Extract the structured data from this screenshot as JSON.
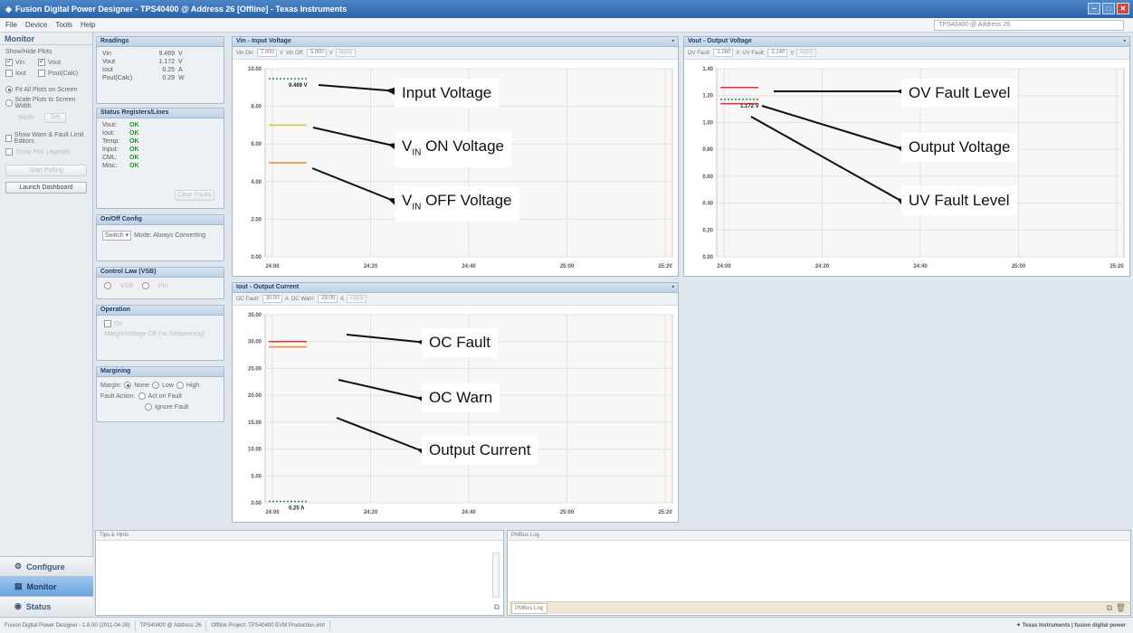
{
  "window": {
    "title": "Fusion Digital Power Designer - TPS40400 @ Address 26 [Offline] - Texas Instruments"
  },
  "menu": {
    "items": [
      "File",
      "Device",
      "Tools",
      "Help"
    ],
    "address": "TPS40400 @ Address 26"
  },
  "nav": {
    "title": "Monitor",
    "show_hide_label": "Show/Hide Plots",
    "checks": [
      {
        "label": "Vin",
        "checked": true
      },
      {
        "label": "Vout",
        "checked": true
      },
      {
        "label": "Iout",
        "checked": false
      },
      {
        "label": "Pout(Calc)",
        "checked": false
      }
    ],
    "fit_all": "Fit All Plots on Screen",
    "scale": "Scale Plots to Screen Width",
    "width_label": "Width",
    "set_label": "Set",
    "show_warn": "Show Warn & Fault Limit Editors",
    "show_plot_legends": "Show Plot Legends",
    "start_polling": "Start Polling",
    "launch_dashboard": "Launch Dashboard",
    "tabs": [
      "Configure",
      "Monitor",
      "Status"
    ]
  },
  "readings": {
    "title": "Readings",
    "rows": [
      {
        "k": "Vin",
        "v": "9.469",
        "u": "V"
      },
      {
        "k": "Vout",
        "v": "1.172",
        "u": "V"
      },
      {
        "k": "Iout",
        "v": "0.25",
        "u": "A"
      },
      {
        "k": "Pout(Calc)",
        "v": "0.29",
        "u": "W"
      }
    ]
  },
  "status_regs": {
    "title": "Status Registers/Lines",
    "rows": [
      {
        "k": "Vout:",
        "v": "OK"
      },
      {
        "k": "Iout:",
        "v": "OK"
      },
      {
        "k": "Temp:",
        "v": "OK"
      },
      {
        "k": "Input:",
        "v": "OK"
      },
      {
        "k": "CML:",
        "v": "OK"
      },
      {
        "k": "Misc:",
        "v": "OK"
      }
    ],
    "clear_faults": "Clear Faults"
  },
  "onoff": {
    "title": "On/Off Config",
    "mode_value": "Switch",
    "mode_label": "Mode: Always Converting"
  },
  "control_law": {
    "title": "Control Law (VSB)",
    "opt1": "VSB",
    "opt2": "Pin"
  },
  "operation": {
    "title": "Operation",
    "on": "On",
    "text": "Margin/Voltage Off (no Sequencing)"
  },
  "margining": {
    "title": "Margining",
    "margin_label": "Margin:",
    "opts": [
      "None",
      "Low",
      "High"
    ],
    "fault_label": "Fault Action:",
    "fault_opts": [
      "Act on Fault",
      "Ignore Fault"
    ]
  },
  "vin_chart": {
    "title": "Vin - Input Voltage",
    "toolbar": {
      "on_label": "Vin On:",
      "on_val": "7.000",
      "off_label": "Vin Off:",
      "off_val": "5.000",
      "unit": "V",
      "apply": "Apply"
    },
    "data_label": "9.469 V"
  },
  "vout_chart": {
    "title": "Vout - Output Voltage",
    "toolbar": {
      "ov_label": "OV Fault:",
      "ov_val": "1.260",
      "uv_label": "UV Fault:",
      "uv_val": "1.140",
      "unit": "V",
      "apply": "Apply"
    },
    "data_label": "1.172 V"
  },
  "iout_chart": {
    "title": "Iout - Output Current",
    "toolbar": {
      "oc_label": "OC Fault:",
      "oc_val": "30.00",
      "warn_label": "OC Warn:",
      "warn_val": "29.00",
      "unit": "A",
      "apply": "Apply"
    },
    "data_label": "0.25 A"
  },
  "chart_data": [
    {
      "type": "line",
      "title": "Vin - Input Voltage",
      "x_ticks": [
        "24:00",
        "24:20",
        "24:40",
        "25:00",
        "25:20"
      ],
      "y_ticks": [
        "0.00",
        "2.00",
        "4.00",
        "6.00",
        "8.00",
        "10.00"
      ],
      "ylim": [
        0,
        10
      ],
      "series": [
        {
          "name": "Input Voltage",
          "values": [
            9.469
          ],
          "color": "#2e8b57",
          "dashed": true
        },
        {
          "name": "VIN ON Voltage",
          "values": [
            7.0
          ],
          "color": "#d8c23a"
        },
        {
          "name": "VIN OFF Voltage",
          "values": [
            5.0
          ],
          "color": "#ee8a2a"
        }
      ]
    },
    {
      "type": "line",
      "title": "Vout - Output Voltage",
      "x_ticks": [
        "24:00",
        "24:20",
        "24:40",
        "25:00",
        "25:20"
      ],
      "y_ticks": [
        "0.00",
        "0.20",
        "0.40",
        "0.60",
        "0.80",
        "1.00",
        "1.20",
        "1.40"
      ],
      "ylim": [
        0,
        1.4
      ],
      "series": [
        {
          "name": "OV Fault Level",
          "values": [
            1.26
          ],
          "color": "#e53030"
        },
        {
          "name": "Output Voltage",
          "values": [
            1.172
          ],
          "color": "#2e8b57",
          "dashed": true
        },
        {
          "name": "UV Fault Level",
          "values": [
            1.14
          ],
          "color": "#e53030"
        }
      ]
    },
    {
      "type": "line",
      "title": "Iout - Output Current",
      "x_ticks": [
        "24:00",
        "24:20",
        "24:40",
        "25:00",
        "25:20"
      ],
      "y_ticks": [
        "0.00",
        "5.00",
        "10.00",
        "15.00",
        "20.00",
        "25.00",
        "30.00",
        "35.00"
      ],
      "ylim": [
        0,
        35
      ],
      "series": [
        {
          "name": "OC Fault",
          "values": [
            30.0
          ],
          "color": "#e53030"
        },
        {
          "name": "OC Warn",
          "values": [
            29.0
          ],
          "color": "#ee8a2a"
        },
        {
          "name": "Output Current",
          "values": [
            0.25
          ],
          "color": "#2e8b57",
          "dashed": true
        }
      ]
    }
  ],
  "annotations": {
    "input_voltage": "Input Voltage",
    "vin_on": {
      "v": "V",
      "sub": "IN",
      "rest": " ON Voltage"
    },
    "vin_off": {
      "v": "V",
      "sub": "IN",
      "rest": " OFF Voltage"
    },
    "ov_fault": "OV Fault Level",
    "output_voltage": "Output Voltage",
    "uv_fault": "UV Fault Level",
    "oc_fault": "OC Fault",
    "oc_warn": "OC Warn",
    "output_current": "Output Current"
  },
  "bottom": {
    "tips_title": "Tips & Hints",
    "log_title": "PMBus Log",
    "log_tab": "PMBus Log"
  },
  "status": {
    "segments": [
      "Fusion Digital Power Designer - 1.8.00 (2011-04-29)",
      "TPS40400 @ Address 26",
      "Offline Project: TPS40400 EVM Production.xml"
    ],
    "brand": "Texas Instruments | fusion digital power"
  }
}
